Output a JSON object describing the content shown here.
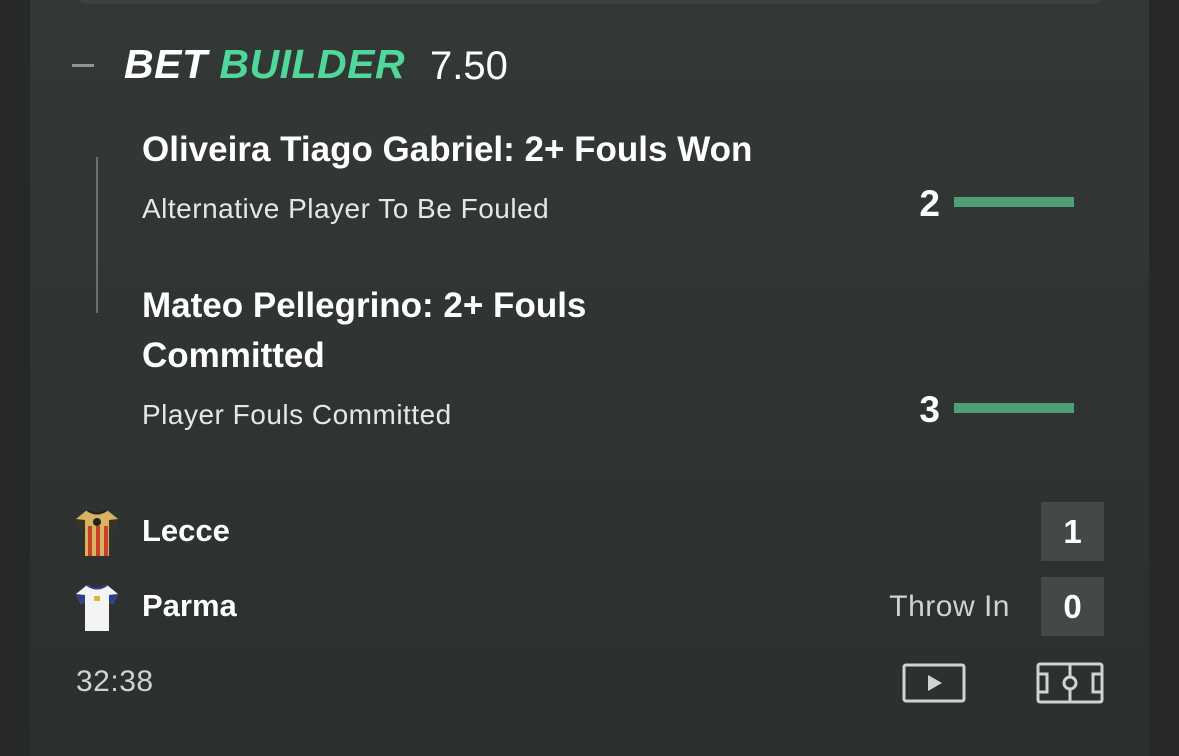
{
  "bet_builder": {
    "title_part1": "BET",
    "title_part2": "BUILDER",
    "odds": "7.50",
    "accent_color": "#4fd89a"
  },
  "selections": [
    {
      "title": "Oliveira Tiago Gabriel: 2+ Fouls Won",
      "market": "Alternative Player To Be Fouled",
      "progress_value": "2",
      "progress_target": 2
    },
    {
      "title": "Mateo Pellegrino: 2+ Fouls Committed",
      "market": "Player Fouls Committed",
      "progress_value": "3",
      "progress_target": 2
    }
  ],
  "match": {
    "home": {
      "name": "Lecce",
      "score": "1",
      "jersey_icon": "lecce-jersey-icon"
    },
    "away": {
      "name": "Parma",
      "score": "0",
      "jersey_icon": "parma-jersey-icon"
    },
    "status": "Throw In",
    "clock": "32:38"
  },
  "icons": {
    "collapse": "minus-icon",
    "video": "play-video-icon",
    "pitch": "pitch-tracker-icon"
  }
}
